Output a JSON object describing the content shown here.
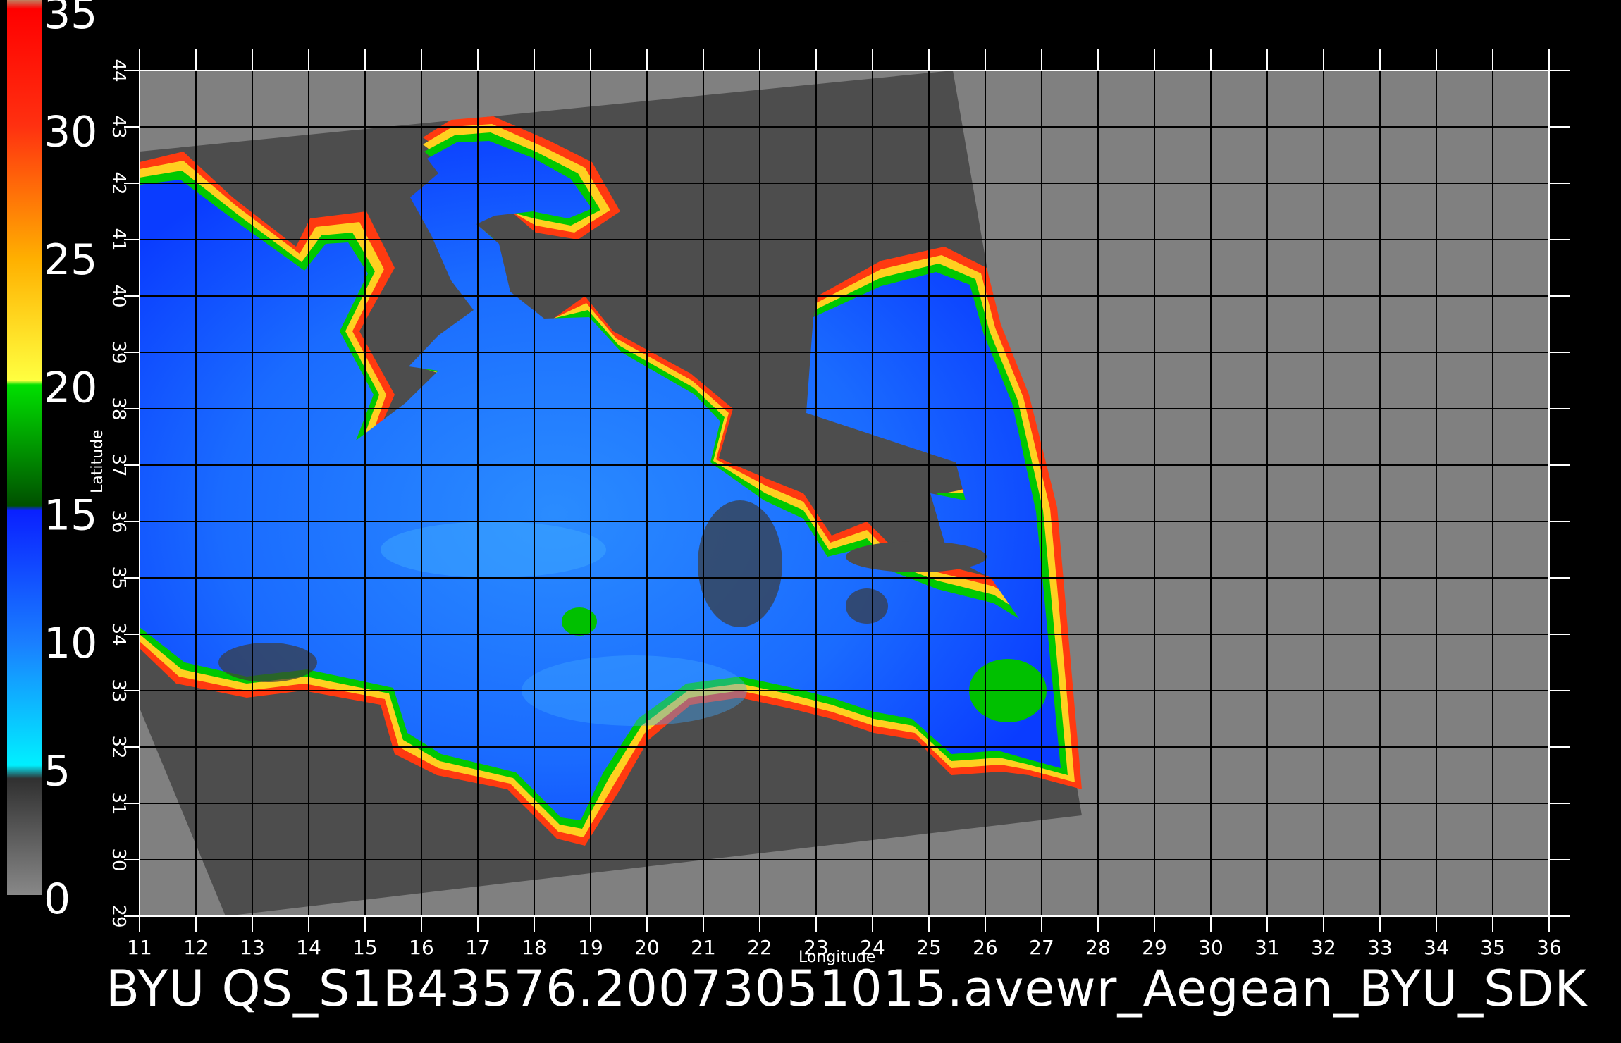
{
  "title": "BYU  QS_S1B43576.20073051015.avewr_Aegean_BYU_SDK",
  "x_axis": {
    "label": "Longitude",
    "min": 11,
    "max": 36,
    "ticks": [
      "11",
      "12",
      "13",
      "14",
      "15",
      "16",
      "17",
      "18",
      "19",
      "20",
      "21",
      "22",
      "23",
      "24",
      "25",
      "26",
      "27",
      "28",
      "29",
      "30",
      "31",
      "32",
      "33",
      "34",
      "35",
      "36"
    ]
  },
  "y_axis": {
    "label": "Latitude",
    "min": 29,
    "max": 44,
    "ticks": [
      "29",
      "30",
      "31",
      "32",
      "33",
      "34",
      "35",
      "36",
      "37",
      "38",
      "39",
      "40",
      "41",
      "42",
      "43",
      "44"
    ]
  },
  "colorbar": {
    "min": 0,
    "max": 35,
    "labels": [
      "0",
      "5",
      "10",
      "15",
      "20",
      "25",
      "30",
      "35"
    ],
    "colors": {
      "c0": "#5a5a5a",
      "c5": "#00f0ff",
      "c10": "#1a6bff",
      "c15": "#0a1cff",
      "c15g": "#006400",
      "c20": "#00e000",
      "c20y": "#ffff30",
      "c25": "#ffb000",
      "c30": "#ff4010",
      "c35": "#ff0000",
      "top": "#c08060"
    }
  },
  "colors": {
    "background": "#000000",
    "no_data_outside": "#808080",
    "swath_land": "#4d4d4d",
    "sea_blue": "#1570ff",
    "grid": "#000000"
  }
}
